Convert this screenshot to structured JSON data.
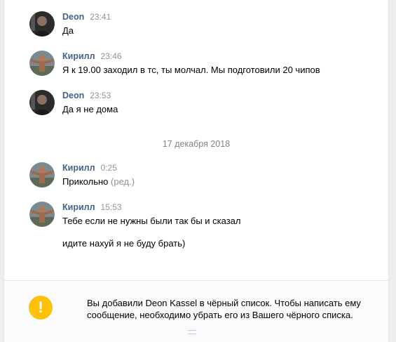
{
  "messages": [
    {
      "author": "Deon",
      "time": "23:41",
      "lines": [
        "Да"
      ]
    },
    {
      "author": "Кирилл",
      "time": "23:46",
      "lines": [
        "Я к 19.00 заходил в тс, ты молчал. Мы подготовили 20 чипов"
      ]
    },
    {
      "author": "Deon",
      "time": "23:53",
      "lines": [
        "Да я не дома"
      ]
    },
    {
      "author": "Кирилл",
      "time": "0:25",
      "lines": [
        "Прикольно"
      ],
      "edited": "(ред.)"
    },
    {
      "author": "Кирилл",
      "time": "15:53",
      "lines": [
        "Тебе если не нужны были так бы и сказал",
        "идите нахуй я не буду брать)"
      ]
    }
  ],
  "date_separator": "17 декабря 2018",
  "blacklist_notice": {
    "icon": "!",
    "text": "Вы добавили Deon Kassel в чёрный список. Чтобы написать ему сообщение, необходимо убрать его из Вашего чёрного списка."
  },
  "colors": {
    "author": "#42648b",
    "time": "#939393",
    "warning": "#ffc107"
  }
}
